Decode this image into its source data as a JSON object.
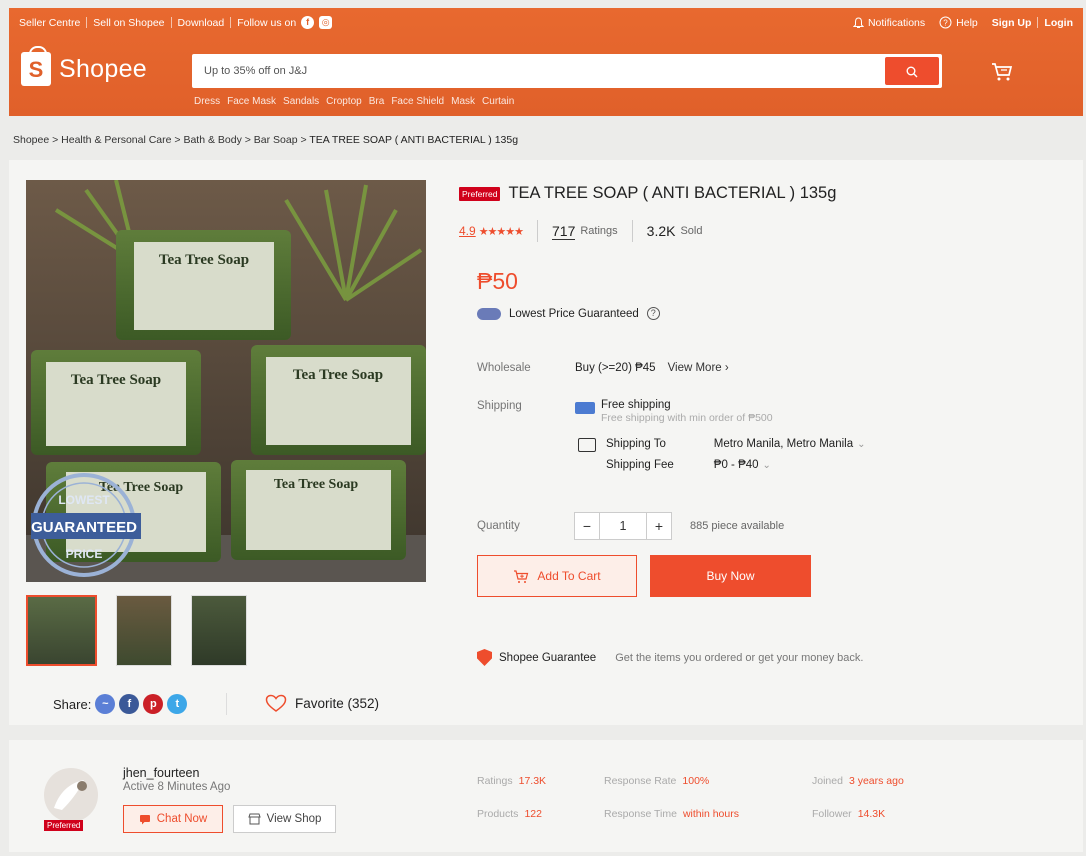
{
  "topbar": {
    "left": [
      "Seller Centre",
      "Sell on Shopee",
      "Download",
      "Follow us on"
    ],
    "notifications": "Notifications",
    "help": "Help",
    "signup": "Sign Up",
    "login": "Login"
  },
  "brand": {
    "name": "Shopee",
    "letter": "S"
  },
  "search": {
    "placeholder": "Up to 35% off on J&J",
    "hints": [
      "Dress",
      "Face Mask",
      "Sandals",
      "Croptop",
      "Bra",
      "Face Shield",
      "Mask",
      "Curtain"
    ]
  },
  "breadcrumb": [
    "Shopee",
    "Health & Personal Care",
    "Bath & Body",
    "Bar Soap",
    "TEA TREE SOAP ( ANTI BACTERIAL ) 135g"
  ],
  "product": {
    "badge": "Preferred",
    "title": "TEA TREE SOAP ( ANTI BACTERIAL ) 135g",
    "rating": "4.9",
    "stars": 4.9,
    "ratings_count": "717",
    "ratings_label": "Ratings",
    "sold_count": "3.2K",
    "sold_label": "Sold",
    "price": "₱50",
    "lowest_price": "Lowest Price Guaranteed",
    "wholesale_label": "Wholesale",
    "wholesale_value": "Buy (>=20) ₱45",
    "view_more": "View More",
    "shipping_label": "Shipping",
    "free_shipping": "Free shipping",
    "free_shipping_sub": "Free shipping with min order of ₱500",
    "shipping_to_label": "Shipping To",
    "shipping_to_value": "Metro Manila, Metro Manila",
    "shipping_fee_label": "Shipping Fee",
    "shipping_fee_value": "₱0 - ₱40",
    "quantity_label": "Quantity",
    "quantity_value": "1",
    "available": "885 piece available",
    "add_to_cart": "Add To Cart",
    "buy_now": "Buy Now",
    "guarantee_title": "Shopee Guarantee",
    "guarantee_text": "Get the items you ordered or get your money back.",
    "share_label": "Share:",
    "favorite": "Favorite (352)",
    "image_texts": {
      "soap": "Tea Tree Soap",
      "stamp_top": "LOWEST",
      "stamp_mid": "GUARANTEED",
      "stamp_bot": "PRICE"
    }
  },
  "seller": {
    "badge": "Preferred",
    "name": "jhen_fourteen",
    "active": "Active 8 Minutes Ago",
    "chat": "Chat Now",
    "view_shop": "View Shop",
    "stats": [
      {
        "label": "Ratings",
        "value": "17.3K"
      },
      {
        "label": "Products",
        "value": "122"
      },
      {
        "label": "Response Rate",
        "value": "100%"
      },
      {
        "label": "Response Time",
        "value": "within hours"
      },
      {
        "label": "Joined",
        "value": "3 years ago"
      },
      {
        "label": "Follower",
        "value": "14.3K"
      }
    ]
  },
  "colors": {
    "brand": "#ee4d2d",
    "header": "#e0602a",
    "preferred": "#d0011b"
  }
}
